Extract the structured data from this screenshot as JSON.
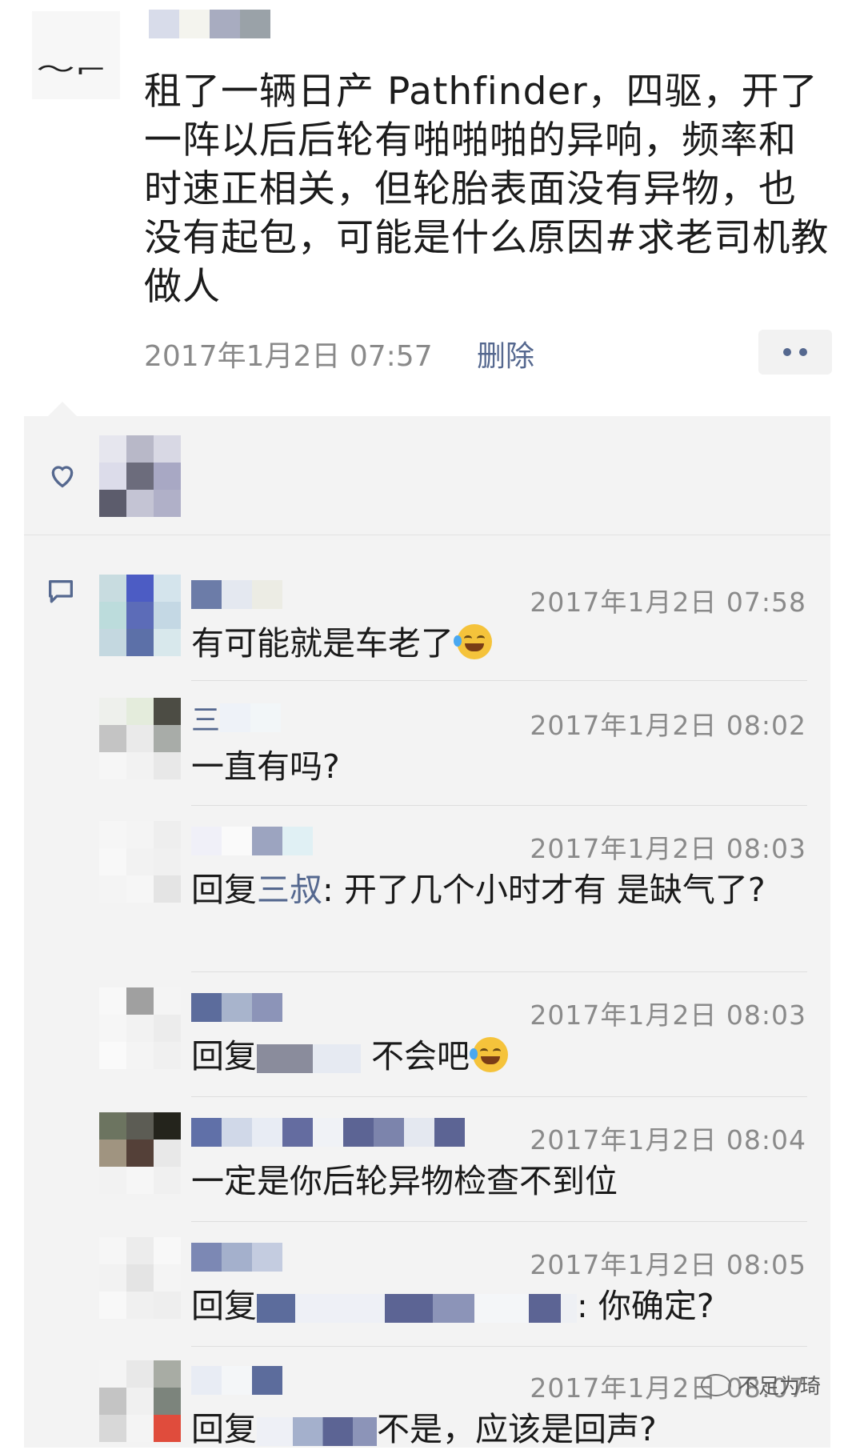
{
  "post": {
    "text": "租了一辆日产 Pathfinder，四驱，开了一阵以后后轮有啪啪啪的异响，频率和时速正相关，但轮胎表面没有异物，也没有起包，可能是什么原因#求老司机教做人",
    "timestamp": "2017年1月2日 07:57",
    "delete_label": "删除",
    "more_icon": "more-dots-icon"
  },
  "likes": {
    "icon": "heart-icon"
  },
  "comments_icon": "comment-bubble-icon",
  "comments": [
    {
      "name": "",
      "time": "2017年1月2日 07:58",
      "text": "有可能就是车老了",
      "emoji": "grinning-sweat"
    },
    {
      "name": "三",
      "time": "2017年1月2日 08:02",
      "text": "一直有吗?"
    },
    {
      "name": "",
      "time": "2017年1月2日 08:03",
      "reply_prefix": "回复",
      "reply_to": "三叔",
      "text": ": 开了几个小时才有  是缺气了?"
    },
    {
      "name": "",
      "time": "2017年1月2日 08:03",
      "reply_prefix": "回复",
      "text": "不会吧",
      "emoji": "tears-of-joy"
    },
    {
      "name": "",
      "time": "2017年1月2日 08:04",
      "text": "一定是你后轮异物检查不到位"
    },
    {
      "name": "",
      "time": "2017年1月2日 08:05",
      "reply_prefix": "回复",
      "text": ": 你确定?"
    },
    {
      "name": "",
      "time": "2017年1月2日 08:07",
      "reply_prefix": "回复",
      "text": "不是，应该是回声?"
    }
  ],
  "watermark": "不足为琦",
  "colors": {
    "link": "#55688f",
    "meta": "#8a8a8a",
    "comment_bg": "#f3f3f3"
  }
}
